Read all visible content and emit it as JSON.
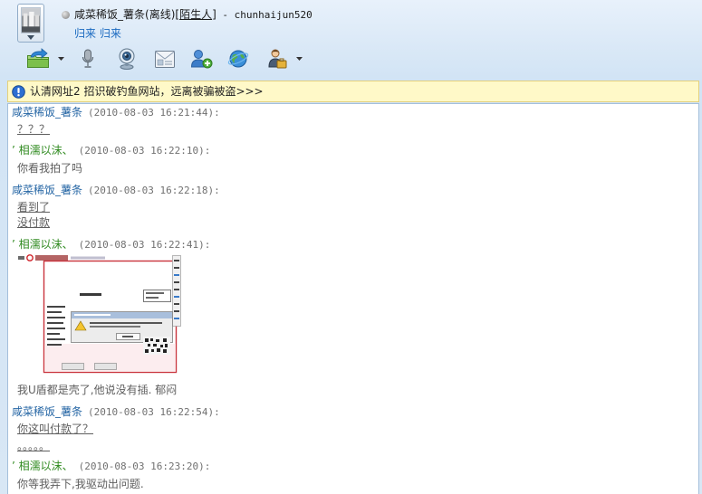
{
  "window": {
    "contact_name": "咸菜稀饭_薯条",
    "status_text": "(离线)",
    "relation_open": "[",
    "relation": "陌生人",
    "relation_close": "]",
    "separator": " - ",
    "contact_id": "chunhaijun520",
    "signature": "归来 归来"
  },
  "toolbar": {
    "items": [
      {
        "icon": "file-transfer-icon",
        "has_dropdown": true
      },
      {
        "icon": "microphone-icon",
        "has_dropdown": false
      },
      {
        "icon": "webcam-icon",
        "has_dropdown": false
      },
      {
        "icon": "mail-card-icon",
        "has_dropdown": false
      },
      {
        "icon": "add-friend-icon",
        "has_dropdown": false
      },
      {
        "icon": "globe-icon",
        "has_dropdown": false
      },
      {
        "icon": "application-icon",
        "has_dropdown": true
      }
    ]
  },
  "notice": {
    "icon": "info-icon",
    "text": "认清网址2 招识破钓鱼网站，远离被骗被盗>>>"
  },
  "messages": [
    {
      "sender": "咸菜稀饭_薯条",
      "time": "(2010-08-03 16:21:44):",
      "lines": [
        "？？？"
      ]
    },
    {
      "sender": "’ 相濡以沫、",
      "time": "(2010-08-03 16:22:10):",
      "lines": [
        "你看我拍了吗"
      ]
    },
    {
      "sender": "咸菜稀饭_薯条",
      "time": "(2010-08-03 16:22:18):",
      "lines": [
        "看到了",
        "没付款"
      ]
    },
    {
      "sender": "’ 相濡以沫、",
      "time": "(2010-08-03 16:22:41):",
      "has_image": true,
      "lines": [
        "我U盾都是壳了,他说没有插. 郁闷"
      ]
    },
    {
      "sender": "咸菜稀饭_薯条",
      "time": "(2010-08-03 16:22:54):",
      "lines": [
        "你这叫付款了？",
        "。。。。。"
      ]
    },
    {
      "sender": "’ 相濡以沫、",
      "time": "(2010-08-03 16:23:20):",
      "lines": [
        "你等我弄下,我驱动出问题."
      ]
    }
  ],
  "colors": {
    "sender-a": "#2767a5",
    "sender-b": "#2f8a1f",
    "timestamp": "#707070",
    "message-text": "#5e5e5e",
    "signature": "#1b6ac0",
    "notice-bg": "#fff9c8",
    "info-icon": "#2d6fd2",
    "title-text": "#1a1a1a",
    "window-bg": "#d8e7f5"
  }
}
